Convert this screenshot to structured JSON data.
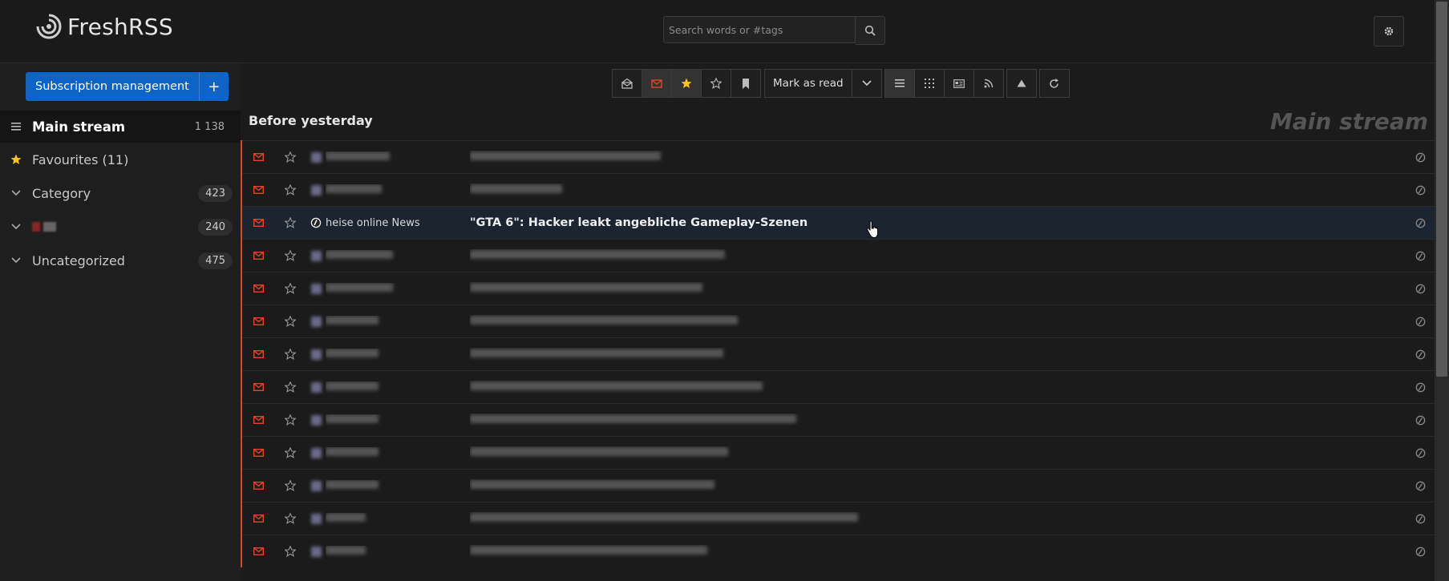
{
  "app": {
    "name": "FreshRSS"
  },
  "search": {
    "placeholder": "Search words or #tags"
  },
  "sidebar": {
    "subscription_label": "Subscription management",
    "add_label": "+",
    "items": [
      {
        "label": "Main stream",
        "count": "1 138"
      },
      {
        "label": "Favourites (11)"
      },
      {
        "label": "Category",
        "count": "423"
      },
      {
        "label": "",
        "count": "240"
      },
      {
        "label": "Uncategorized",
        "count": "475"
      }
    ]
  },
  "toolbar": {
    "mark_read_label": "Mark as read"
  },
  "main": {
    "day_heading": "Before yesterday",
    "stream_label": "Main stream",
    "highlighted": {
      "feed": "heise online News",
      "title": "\"GTA 6\": Hacker leakt angebliche Gameplay-Szenen"
    }
  },
  "colors": {
    "accent": "#0e63c7",
    "unread": "#e2452b",
    "star": "#f5c518"
  }
}
